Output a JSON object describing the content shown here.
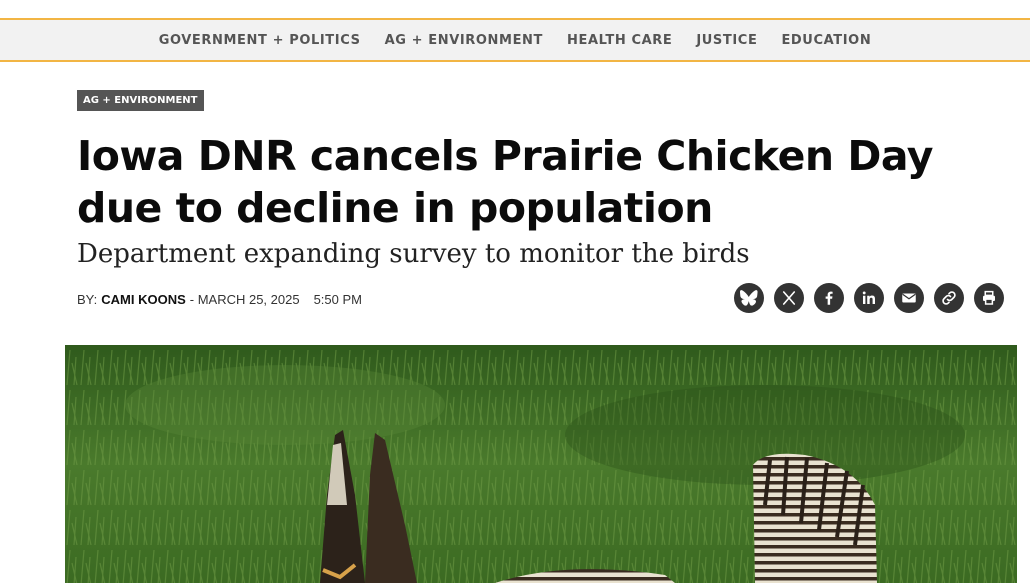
{
  "nav": {
    "items": [
      {
        "label": "GOVERNMENT + POLITICS"
      },
      {
        "label": "AG + ENVIRONMENT"
      },
      {
        "label": "HEALTH CARE"
      },
      {
        "label": "JUSTICE"
      },
      {
        "label": "EDUCATION"
      }
    ]
  },
  "article": {
    "category": "AG + ENVIRONMENT",
    "headline": "Iowa DNR cancels Prairie Chicken Day due to decline in population",
    "subhead": "Department expanding survey to monitor the birds",
    "byline": {
      "prefix": "BY:",
      "author": "CAMI KOONS",
      "date": "- MARCH 25, 2025",
      "time": "5:50 PM"
    }
  },
  "share": {
    "icons": [
      "bluesky-icon",
      "x-icon",
      "facebook-icon",
      "linkedin-icon",
      "email-icon",
      "link-icon",
      "print-icon"
    ]
  },
  "colors": {
    "nav_border": "#f2b544",
    "nav_bg": "#f2f2f2",
    "category_bg": "#555555",
    "share_bg": "#333333"
  }
}
